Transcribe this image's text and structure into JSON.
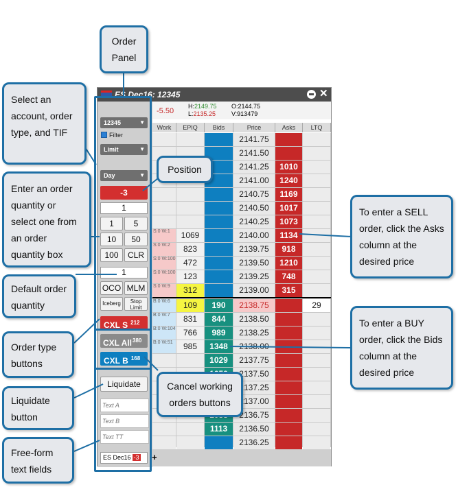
{
  "window": {
    "title": "ES Dec16: 12345"
  },
  "header": {
    "pnl": "-5.50",
    "high_lbl": "H:",
    "high": "2149.75",
    "low_lbl": "L:",
    "low": "2135.25",
    "open_lbl": "O:",
    "open": "2144.75",
    "vol_lbl": "V:",
    "volume": "913479"
  },
  "columns": [
    "Work",
    "EPIQ",
    "Bids",
    "Price",
    "Asks",
    "LTQ"
  ],
  "panel": {
    "account": "12345",
    "filter": "Filter",
    "order_type": "Limit",
    "tif": "Day",
    "position": "-3",
    "qty": "1",
    "qty_buttons": [
      "1",
      "5",
      "10",
      "50",
      "100",
      "CLR"
    ],
    "default_qty": "1",
    "oco": "OCO",
    "mlm": "MLM",
    "iceberg": "Iceberg",
    "stop_limit": "Stop Limit",
    "cxl_s": "CXL S",
    "cxl_s_count": "212",
    "cxl_all": "CXL All",
    "cxl_all_count": "380",
    "cxl_b": "CXL B",
    "cxl_b_count": "168",
    "liquidate": "Liquidate",
    "text_a": "Text A",
    "text_b": "Text B",
    "text_tt": "Text TT"
  },
  "rows": [
    {
      "work": "",
      "epiq": "",
      "bid": "",
      "price": "2141.75",
      "ask": "",
      "ltq": ""
    },
    {
      "work": "",
      "epiq": "",
      "bid": "",
      "price": "2141.50",
      "ask": "",
      "ltq": ""
    },
    {
      "work": "",
      "epiq": "",
      "bid": "",
      "price": "2141.25",
      "ask": "1010",
      "ltq": ""
    },
    {
      "work": "",
      "epiq": "",
      "bid": "",
      "price": "2141.00",
      "ask": "1240",
      "ltq": ""
    },
    {
      "work": "",
      "epiq": "",
      "bid": "",
      "price": "2140.75",
      "ask": "1169",
      "ltq": ""
    },
    {
      "work": "",
      "epiq": "",
      "bid": "",
      "price": "2140.50",
      "ask": "1017",
      "ltq": ""
    },
    {
      "work": "",
      "epiq": "",
      "bid": "",
      "price": "2140.25",
      "ask": "1073",
      "ltq": ""
    },
    {
      "work": "S:0 W:1",
      "epiq": "1069",
      "bid": "",
      "price": "2140.00",
      "ask": "1134",
      "ltq": ""
    },
    {
      "work": "S:0 W:2",
      "epiq": "823",
      "bid": "",
      "price": "2139.75",
      "ask": "918",
      "ltq": ""
    },
    {
      "work": "S:0 W:100",
      "epiq": "472",
      "bid": "",
      "price": "2139.50",
      "ask": "1210",
      "ltq": ""
    },
    {
      "work": "S:0 W:100",
      "epiq": "123",
      "bid": "",
      "price": "2139.25",
      "ask": "748",
      "ltq": ""
    },
    {
      "work": "S:0 W:9",
      "epiq": "312",
      "bid": "",
      "price": "2139.00",
      "ask": "315",
      "ltq": ""
    },
    {
      "work": "B:0 W:6",
      "epiq": "109",
      "bid": "190",
      "price": "2138.75",
      "ask": "",
      "ltq": "29"
    },
    {
      "work": "B:0 W:7",
      "epiq": "831",
      "bid": "844",
      "price": "2138.50",
      "ask": "",
      "ltq": ""
    },
    {
      "work": "B:0 W:104",
      "epiq": "766",
      "bid": "989",
      "price": "2138.25",
      "ask": "",
      "ltq": ""
    },
    {
      "work": "B:0 W:51",
      "epiq": "985",
      "bid": "1348",
      "price": "2138.00",
      "ask": "",
      "ltq": ""
    },
    {
      "work": "",
      "epiq": "",
      "bid": "1029",
      "price": "2137.75",
      "ask": "",
      "ltq": ""
    },
    {
      "work": "",
      "epiq": "",
      "bid": "1050",
      "price": "2137.50",
      "ask": "",
      "ltq": ""
    },
    {
      "work": "",
      "epiq": "",
      "bid": "1050",
      "price": "2137.25",
      "ask": "",
      "ltq": ""
    },
    {
      "work": "",
      "epiq": "",
      "bid": "1089",
      "price": "2137.00",
      "ask": "",
      "ltq": ""
    },
    {
      "work": "",
      "epiq": "",
      "bid": "1058",
      "price": "2136.75",
      "ask": "",
      "ltq": ""
    },
    {
      "work": "",
      "epiq": "",
      "bid": "1113",
      "price": "2136.50",
      "ask": "",
      "ltq": ""
    },
    {
      "work": "",
      "epiq": "",
      "bid": "",
      "price": "2136.25",
      "ask": "",
      "ltq": ""
    }
  ],
  "bottom_tab": {
    "label": "ES Dec16",
    "badge": "-3",
    "add": "+"
  },
  "callouts": {
    "order_panel": "Order Panel",
    "select": "Select an account, order type, and TIF",
    "position": "Position",
    "enter_qty": "Enter an order quantity or select one from an order quantity box",
    "default_qty": "Default order quantity",
    "order_type": "Order type buttons",
    "liquidate": "Liquidate button",
    "freeform": "Free-form text fields",
    "cancel": "Cancel working orders buttons",
    "sell": "To enter a SELL order, click the Asks column at the desired price",
    "buy": "To enter a BUY order, click the Bids column at the desired price"
  },
  "colors": {
    "bid": "#0e7fc0",
    "ask": "#c62828",
    "teal": "#17907f",
    "callout_border": "#1e6fa5"
  }
}
